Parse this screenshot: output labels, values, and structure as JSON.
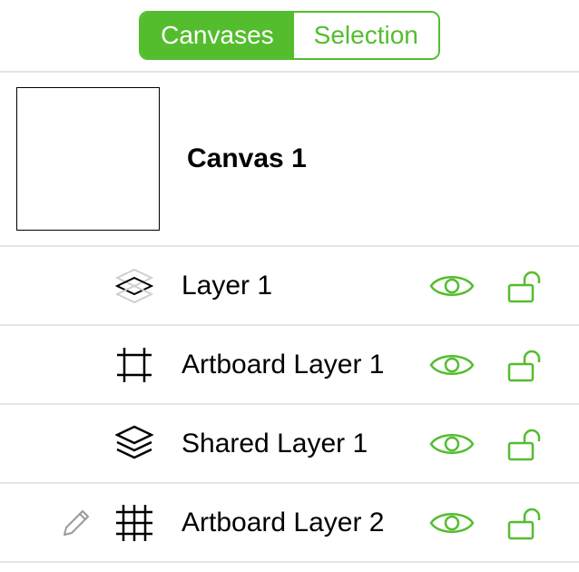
{
  "tabs": {
    "canvases": "Canvases",
    "selection": "Selection"
  },
  "canvas": {
    "name": "Canvas 1"
  },
  "layers": [
    {
      "name": "Layer 1",
      "icon": "layer-icon",
      "editing": false
    },
    {
      "name": "Artboard Layer 1",
      "icon": "artboard-icon",
      "editing": false
    },
    {
      "name": "Shared Layer 1",
      "icon": "shared-layer-icon",
      "editing": false
    },
    {
      "name": "Artboard Layer 2",
      "icon": "grid-icon",
      "editing": true
    }
  ],
  "colors": {
    "accent": "#54bd2e"
  }
}
